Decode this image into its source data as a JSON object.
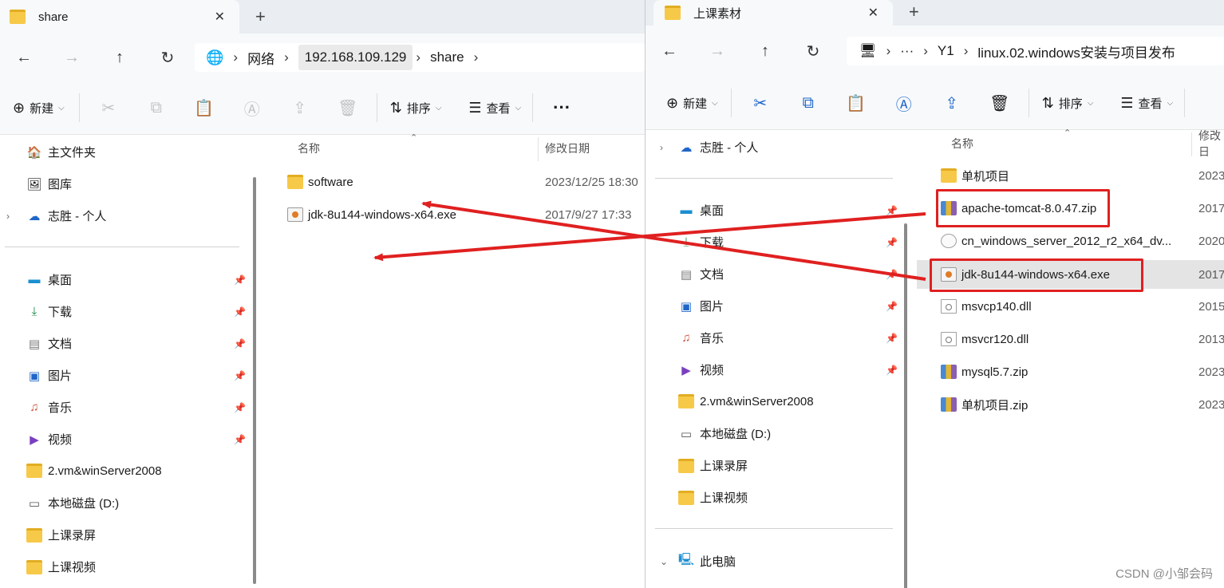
{
  "left_window": {
    "tab_title": "share",
    "breadcrumbs": [
      "网络",
      "192.168.109.129",
      "share"
    ],
    "commands": {
      "new_label": "新建",
      "sort_label": "排序",
      "view_label": "查看"
    },
    "nav_items": [
      {
        "label": "主文件夹",
        "icon": "home-icon"
      },
      {
        "label": "图库",
        "icon": "gallery-icon"
      },
      {
        "label": "志胜 - 个人",
        "icon": "onedrive-cloud-icon"
      },
      {
        "label": "桌面",
        "icon": "desktop-icon"
      },
      {
        "label": "下载",
        "icon": "download-icon"
      },
      {
        "label": "文档",
        "icon": "document-icon"
      },
      {
        "label": "图片",
        "icon": "pictures-icon"
      },
      {
        "label": "音乐",
        "icon": "music-icon"
      },
      {
        "label": "视频",
        "icon": "video-icon"
      },
      {
        "label": "2.vm&winServer2008",
        "icon": "folder-icon"
      },
      {
        "label": "本地磁盘 (D:)",
        "icon": "drive-icon"
      },
      {
        "label": "上课录屏",
        "icon": "folder-icon"
      },
      {
        "label": "上课视频",
        "icon": "folder-icon"
      }
    ],
    "columns": {
      "name": "名称",
      "modified": "修改日期"
    },
    "files": [
      {
        "name": "software",
        "modified": "2023/12/25 18:30",
        "type": "folder"
      },
      {
        "name": "jdk-8u144-windows-x64.exe",
        "modified": "2017/9/27 17:33",
        "type": "exe"
      }
    ]
  },
  "right_window": {
    "tab_title": "上课素材",
    "breadcrumbs": [
      "···",
      "Y1",
      "linux.02.windows安装与项目发布"
    ],
    "commands": {
      "new_label": "新建",
      "sort_label": "排序",
      "view_label": "查看"
    },
    "nav_items": [
      {
        "label": "志胜 - 个人",
        "icon": "onedrive-cloud-icon"
      },
      {
        "label": "桌面",
        "icon": "desktop-icon"
      },
      {
        "label": "下载",
        "icon": "download-icon"
      },
      {
        "label": "文档",
        "icon": "document-icon"
      },
      {
        "label": "图片",
        "icon": "pictures-icon"
      },
      {
        "label": "音乐",
        "icon": "music-icon"
      },
      {
        "label": "视频",
        "icon": "video-icon"
      },
      {
        "label": "2.vm&winServer2008",
        "icon": "folder-icon"
      },
      {
        "label": "本地磁盘 (D:)",
        "icon": "drive-icon"
      },
      {
        "label": "上课录屏",
        "icon": "folder-icon"
      },
      {
        "label": "上课视频",
        "icon": "folder-icon"
      },
      {
        "label": "此电脑",
        "icon": "computer-icon"
      }
    ],
    "columns": {
      "name": "名称",
      "modified": "修改日"
    },
    "files": [
      {
        "name": "单机项目",
        "modified": "2023",
        "type": "folder"
      },
      {
        "name": "apache-tomcat-8.0.47.zip",
        "modified": "2017",
        "type": "zip"
      },
      {
        "name": "cn_windows_server_2012_r2_x64_dv...",
        "modified": "2020",
        "type": "iso"
      },
      {
        "name": "jdk-8u144-windows-x64.exe",
        "modified": "2017",
        "type": "exe"
      },
      {
        "name": "msvcp140.dll",
        "modified": "2015",
        "type": "dll"
      },
      {
        "name": "msvcr120.dll",
        "modified": "2013",
        "type": "dll"
      },
      {
        "name": "mysql5.7.zip",
        "modified": "2023",
        "type": "zip"
      },
      {
        "name": "单机项目.zip",
        "modified": "2023",
        "type": "zip"
      }
    ]
  },
  "annotation_color": "#e02020",
  "watermark": "CSDN @小邹会码"
}
